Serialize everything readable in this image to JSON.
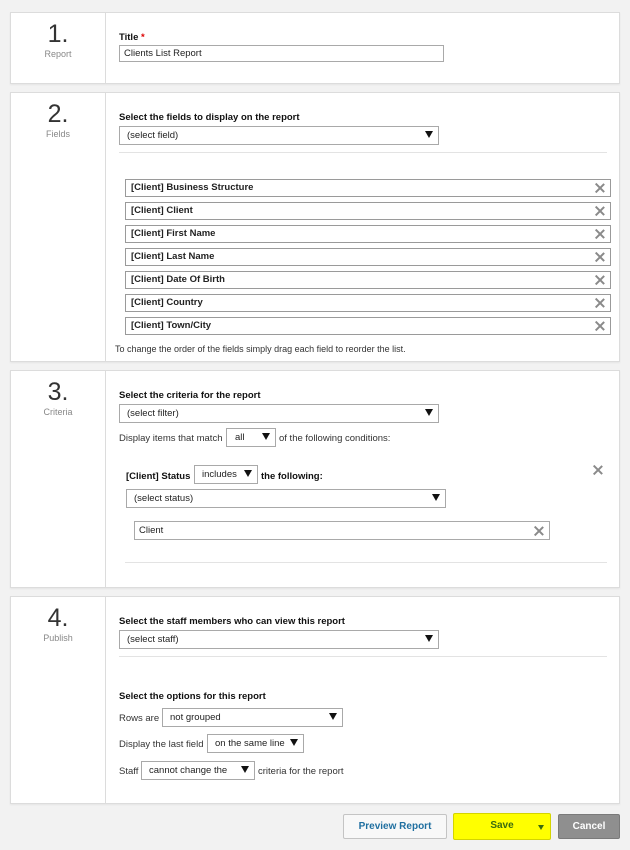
{
  "sections": {
    "report": {
      "num": "1.",
      "label": "Report",
      "title_label": "Title",
      "required": "*",
      "title_value": "Clients List Report"
    },
    "fields": {
      "num": "2.",
      "label": "Fields",
      "heading": "Select the fields to display on the report",
      "select_value": "(select field)",
      "items": [
        "[Client] Business Structure",
        "[Client] Client",
        "[Client] First Name",
        "[Client] Last Name",
        "[Client] Date Of Birth",
        "[Client] Country",
        "[Client] Town/City"
      ],
      "hint": "To change the order of the fields simply drag each field to reorder the list."
    },
    "criteria": {
      "num": "3.",
      "label": "Criteria",
      "heading": "Select the criteria for the report",
      "filter_value": "(select filter)",
      "match_prefix": "Display items that match",
      "match_value": "all",
      "match_suffix": "of the following conditions:",
      "condition_field": "[Client] Status",
      "condition_op": "includes",
      "condition_suffix": "the following:",
      "status_select": "(select status)",
      "status_item": "Client"
    },
    "publish": {
      "num": "4.",
      "label": "Publish",
      "heading": "Select the staff members who can view this report",
      "staff_select": "(select staff)",
      "options_heading": "Select the options for this report",
      "rows_label": "Rows are",
      "rows_value": "not grouped",
      "display_label": "Display the last field",
      "display_value": "on the same line",
      "staff_label": "Staff",
      "staff_value": "cannot change the",
      "staff_suffix": "criteria for the report"
    }
  },
  "buttons": {
    "preview": "Preview Report",
    "save": "Save",
    "cancel": "Cancel"
  },
  "colors": {
    "save_bg": "#ffff00",
    "preview_text": "#1f6fa0",
    "cancel_bg": "#8f8f8f"
  }
}
